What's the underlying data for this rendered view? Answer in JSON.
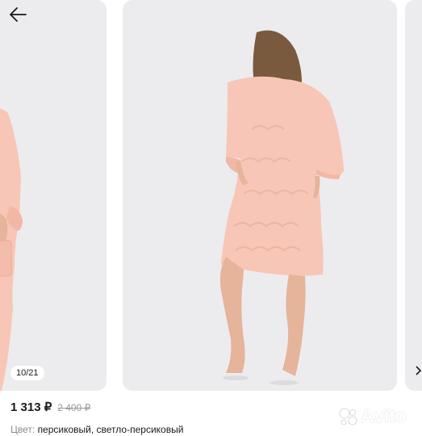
{
  "gallery": {
    "counter": "10/21"
  },
  "product": {
    "price": "1 313 ₽",
    "old_price": "2 400 ₽",
    "color_label": "Цвет: ",
    "color_value": "персиковый, светло-персиковый"
  },
  "watermark": {
    "text": "Avito"
  },
  "colors": {
    "dress": "#f8c6b6",
    "background": "#ececee",
    "skin": "#e6b49a",
    "hair": "#7a5a3e"
  },
  "icons": {
    "back": "arrow-left-icon",
    "next": "chevron-right-icon",
    "logo": "avito-logo-icon"
  }
}
